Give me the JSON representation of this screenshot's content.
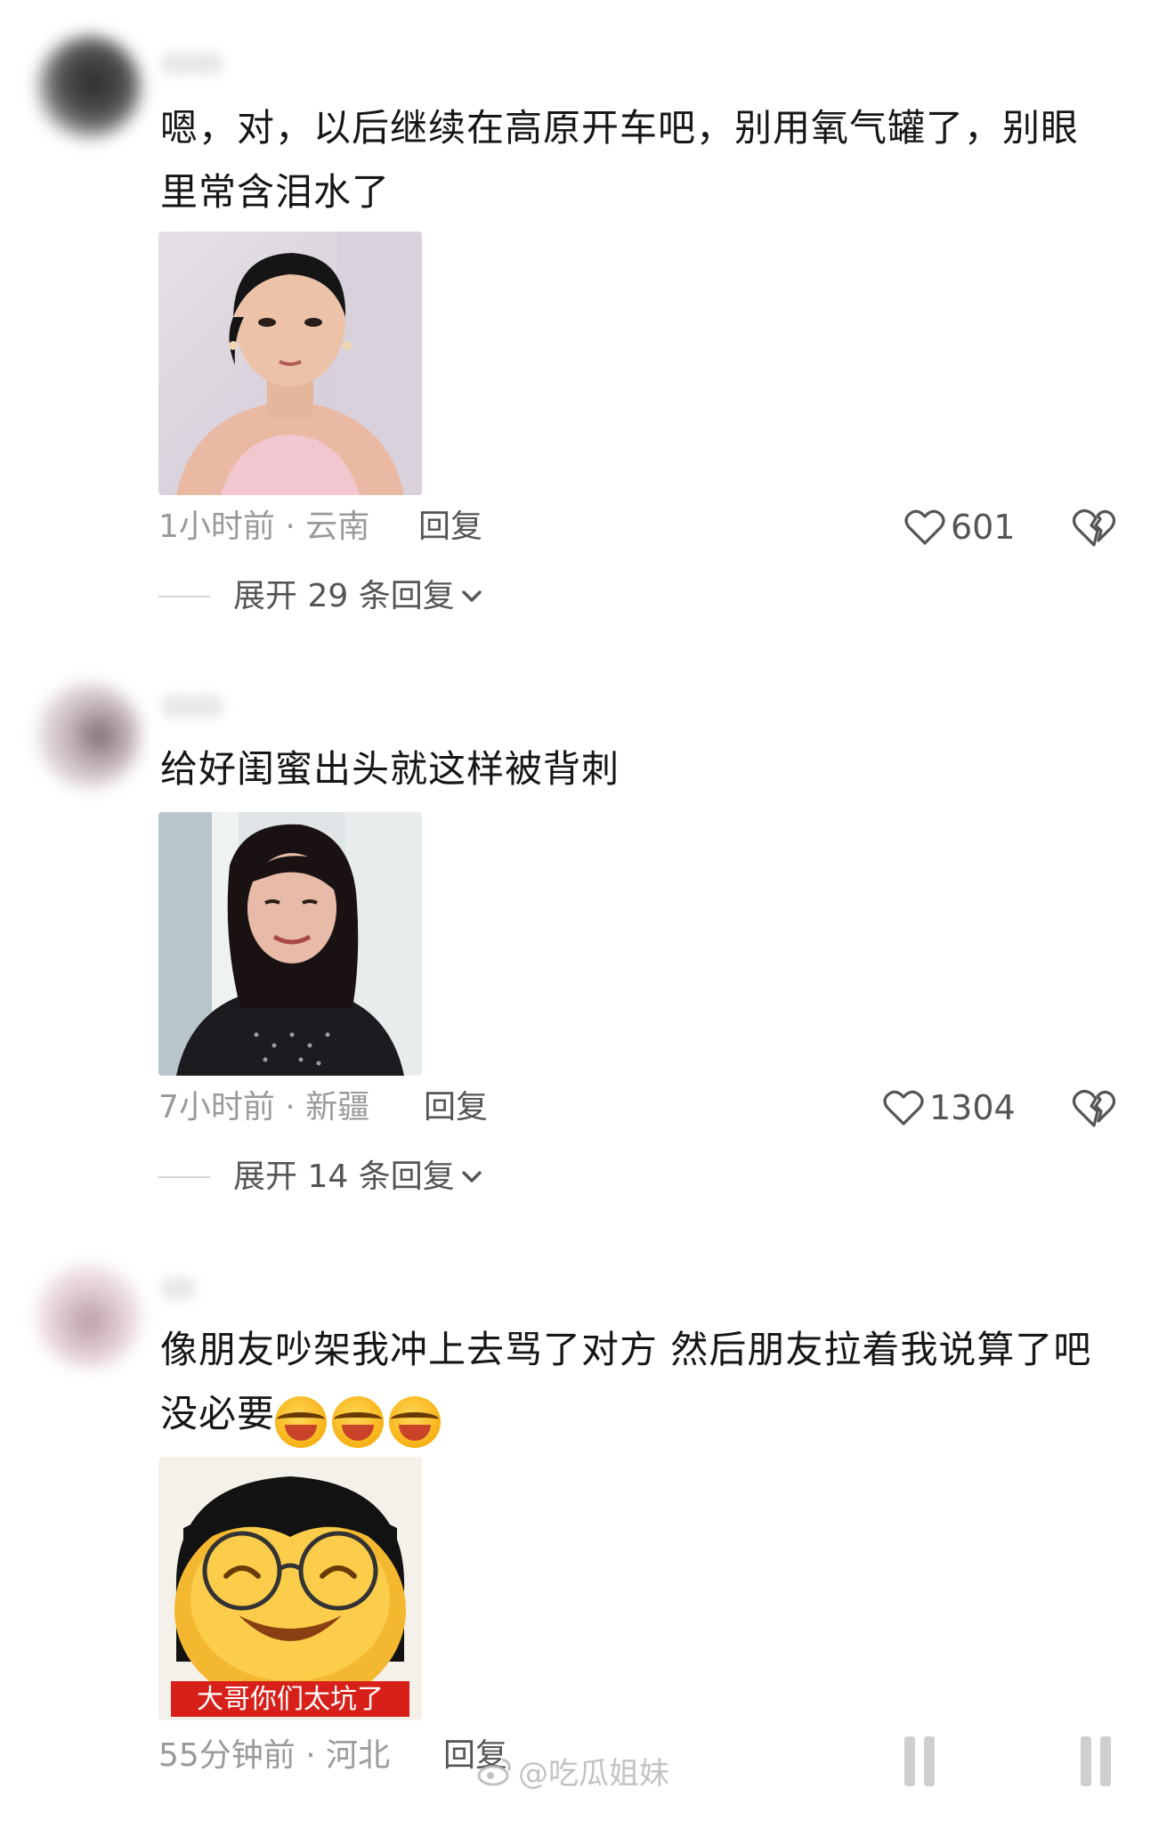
{
  "comments": [
    {
      "text": "嗯，对，以后继续在高原开车吧，别用氧气罐了，别眼里常含泪水了",
      "time": "1小时前 · 云南",
      "reply_label": "回复",
      "likes": "601",
      "expand_label": "展开 29 条回复"
    },
    {
      "text": "给好闺蜜出头就这样被背刺",
      "time": "7小时前 · 新疆",
      "reply_label": "回复",
      "likes": "1304",
      "expand_label": "展开 14 条回复"
    },
    {
      "text": "像朋友吵架我冲上去骂了对方 然后朋友拉着我说算了吧没必要",
      "time": "55分钟前 · 河北",
      "reply_label": "回复",
      "meme_caption": "大哥你们太坑了"
    }
  ],
  "watermark": "@吃瓜姐妹",
  "icons": {
    "like": "heart-outline-icon",
    "dislike": "broken-heart-icon",
    "expand": "chevron-down-icon",
    "reaction": "laugh-cry-emoji",
    "watermark": "weibo-logo-icon"
  },
  "colors": {
    "text": "#161616",
    "meta": "#9a9a9a",
    "action": "#555555",
    "meme_caption_bg": "#d8201a"
  }
}
